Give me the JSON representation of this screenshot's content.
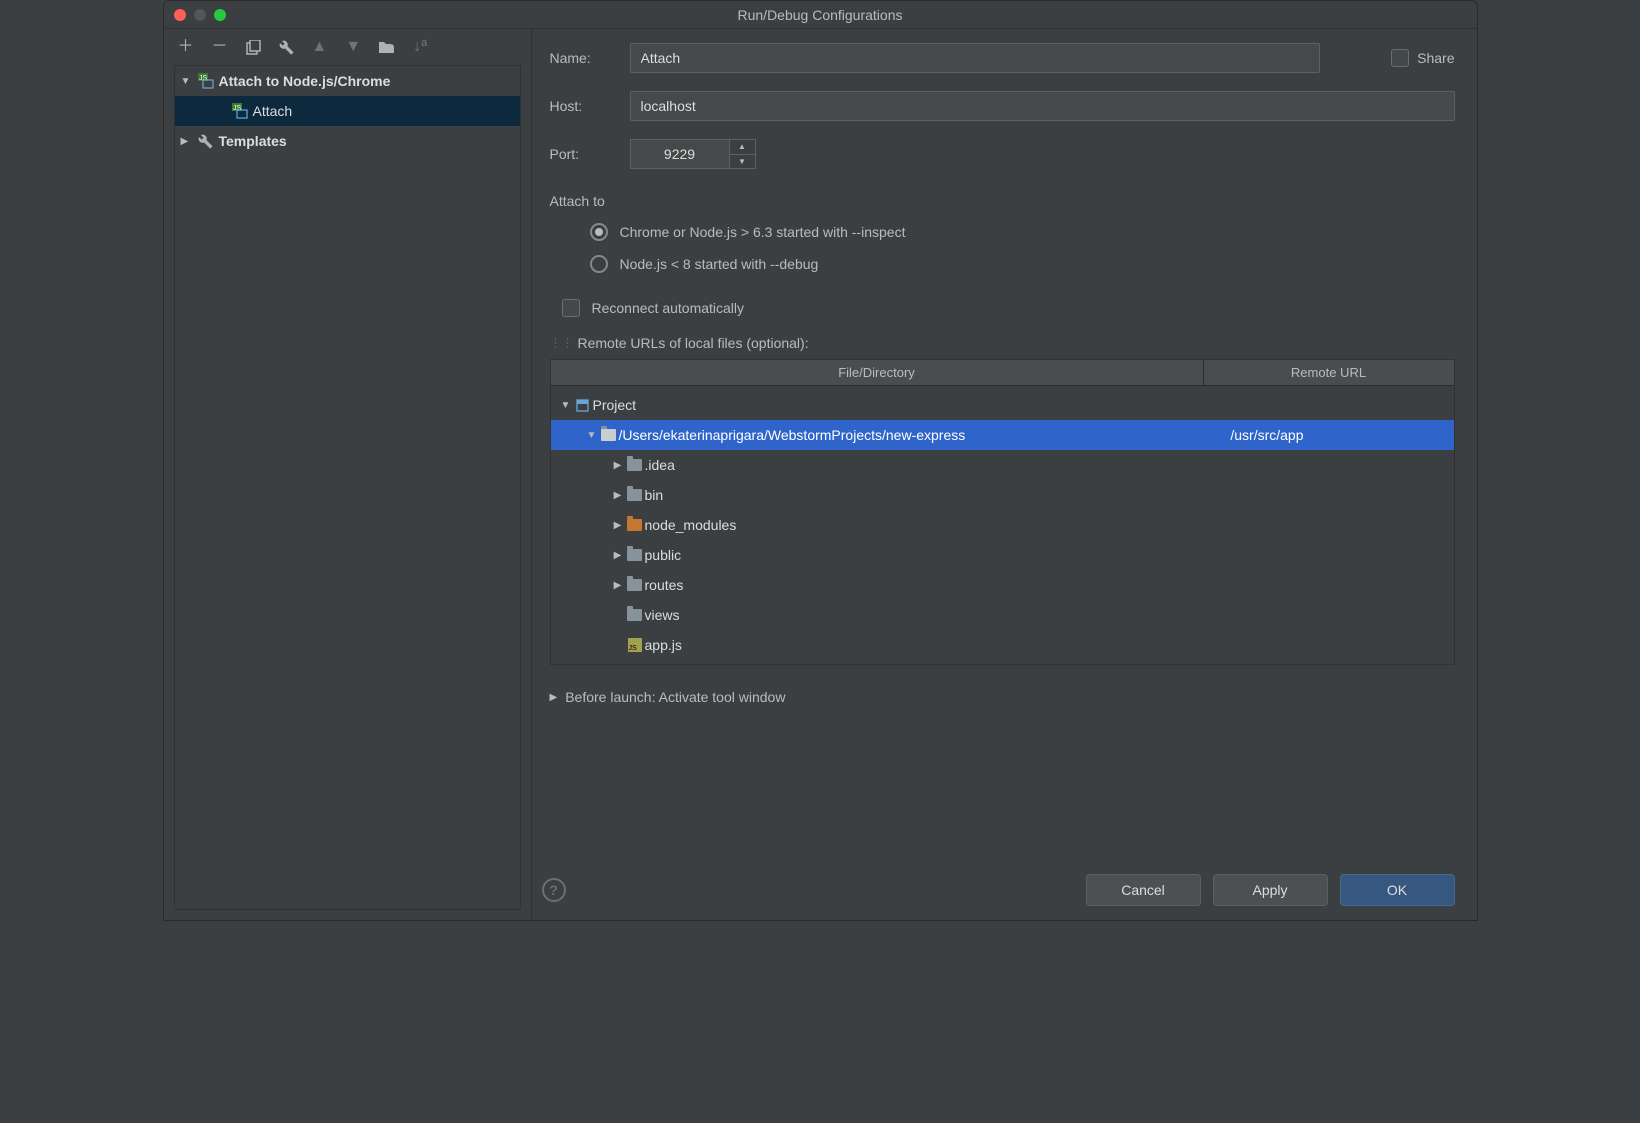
{
  "window": {
    "title": "Run/Debug Configurations"
  },
  "sidebar": {
    "config_group": "Attach to Node.js/Chrome",
    "config_item": "Attach",
    "templates": "Templates"
  },
  "form": {
    "name_label": "Name:",
    "name_value": "Attach",
    "share_label": "Share",
    "host_label": "Host:",
    "host_value": "localhost",
    "port_label": "Port:",
    "port_value": "9229",
    "attach_to_title": "Attach to",
    "radio_inspect": "Chrome or Node.js > 6.3 started with --inspect",
    "radio_debug": "Node.js < 8 started with --debug",
    "reconnect_label": "Reconnect automatically",
    "remote_urls_title": "Remote URLs of local files (optional):"
  },
  "table": {
    "col_file": "File/Directory",
    "col_remote": "Remote URL",
    "rows": {
      "project": "Project",
      "root_path": "/Users/ekaterinaprigara/WebstormProjects/new-express",
      "root_remote": "/usr/src/app",
      "idea": ".idea",
      "bin": "bin",
      "node_modules": "node_modules",
      "public": "public",
      "routes": "routes",
      "views": "views",
      "appjs": "app.js"
    }
  },
  "before_launch": "Before launch: Activate tool window",
  "buttons": {
    "cancel": "Cancel",
    "apply": "Apply",
    "ok": "OK"
  }
}
